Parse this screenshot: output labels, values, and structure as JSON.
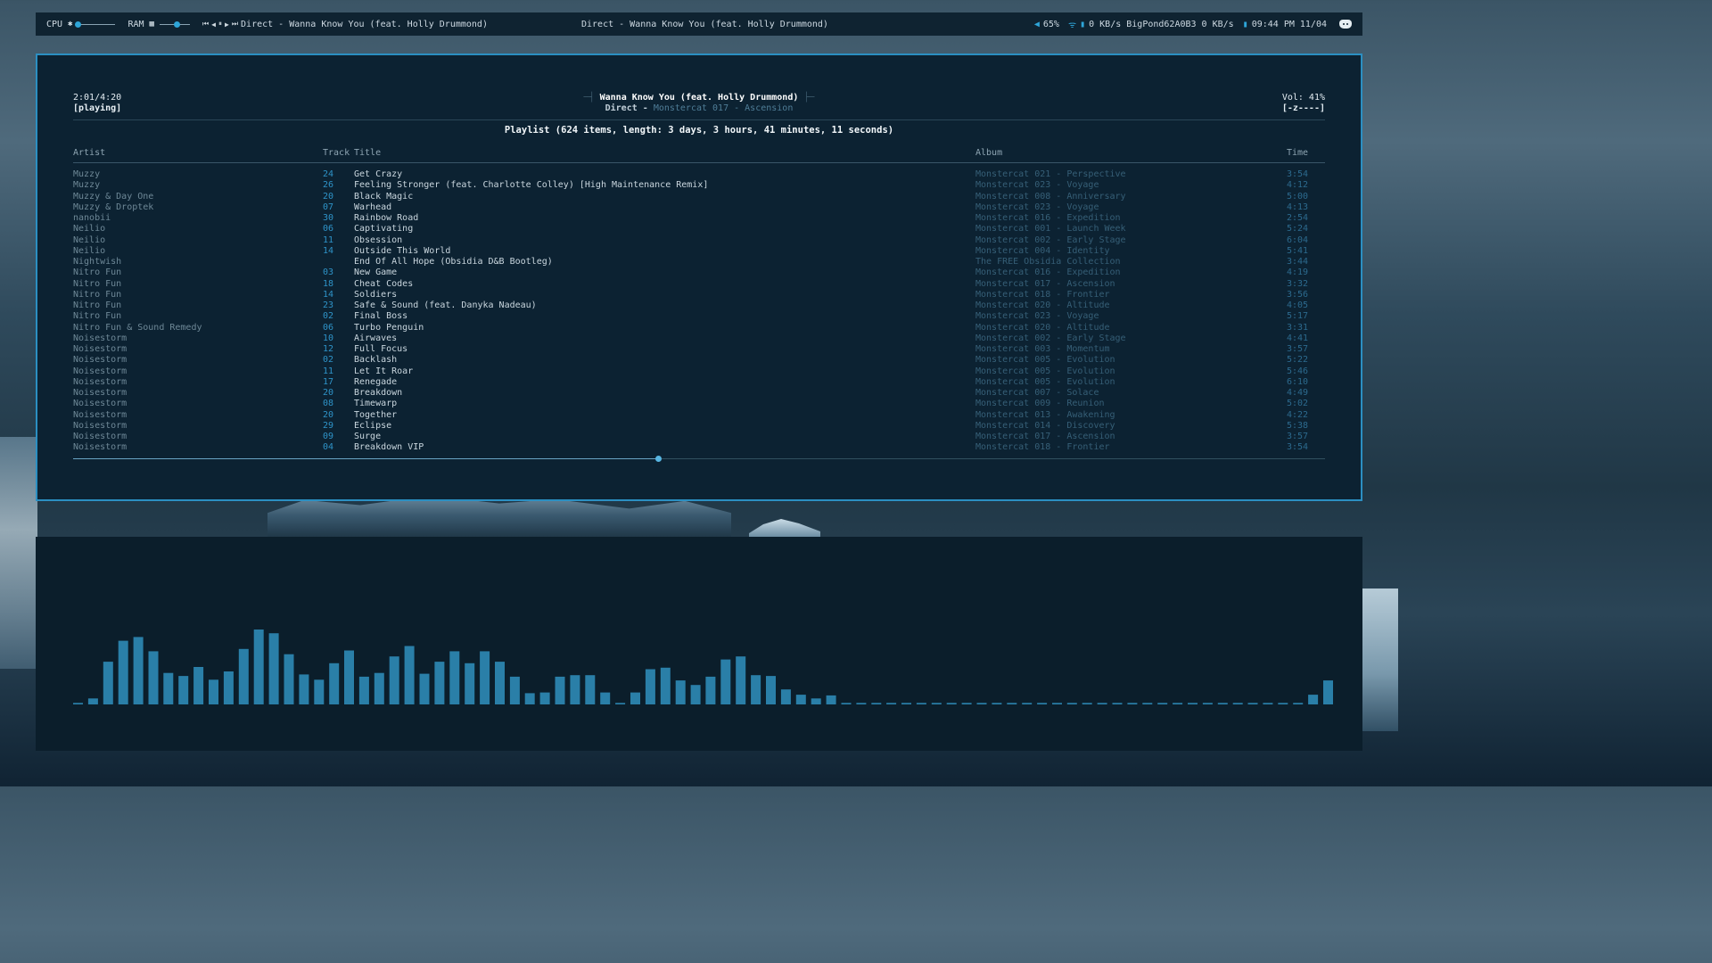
{
  "topbar": {
    "cpu_label": "CPU",
    "ram_label": "RAM",
    "media_controls": [
      "⏮",
      "◀",
      "⏸",
      "▶",
      "⏭"
    ],
    "now_playing": "Direct - Wanna Know You (feat. Holly Drummond)",
    "center_title": "Direct - Wanna Know You (feat. Holly Drummond)",
    "volume": "65%",
    "network": "0 KB/s BigPond62A0B3 0 KB/s",
    "clock": "09:44 PM 11/04",
    "accent": "#2ea5d8"
  },
  "player": {
    "elapsed": "2:01/4:20",
    "state": "[playing]",
    "song_title": "Wanna Know You (feat. Holly Drummond)",
    "artist": "Direct",
    "album": "Monstercat 017 - Ascension",
    "volume": "Vol: 41%",
    "mode_flags": "[-z----]",
    "progress": 0.467
  },
  "playlist": {
    "summary": "Playlist (624 items, length: 3 days, 3 hours, 41 minutes, 11 seconds)",
    "columns": [
      "Artist",
      "Track",
      "Title",
      "Album",
      "Time"
    ],
    "rows": [
      [
        "Muzzy",
        "24",
        "Get Crazy",
        "Monstercat 021 - Perspective",
        "3:54"
      ],
      [
        "Muzzy",
        "26",
        "Feeling Stronger (feat. Charlotte Colley) [High Maintenance Remix]",
        "Monstercat 023 - Voyage",
        "4:12"
      ],
      [
        "Muzzy & Day One",
        "20",
        "Black Magic",
        "Monstercat 008 - Anniversary",
        "5:00"
      ],
      [
        "Muzzy & Droptek",
        "07",
        "Warhead",
        "Monstercat 023 - Voyage",
        "4:13"
      ],
      [
        "nanobii",
        "30",
        "Rainbow Road",
        "Monstercat 016 - Expedition",
        "2:54"
      ],
      [
        "Neilio",
        "06",
        "Captivating",
        "Monstercat 001 - Launch Week",
        "5:24"
      ],
      [
        "Neilio",
        "11",
        "Obsession",
        "Monstercat 002 - Early Stage",
        "6:04"
      ],
      [
        "Neilio",
        "14",
        "Outside This World",
        "Monstercat 004 - Identity",
        "5:41"
      ],
      [
        "Nightwish",
        "",
        "End Of All Hope (Obsidia D&B Bootleg)",
        "The FREE Obsidia Collection",
        "3:44"
      ],
      [
        "Nitro Fun",
        "03",
        "New Game",
        "Monstercat 016 - Expedition",
        "4:19"
      ],
      [
        "Nitro Fun",
        "18",
        "Cheat Codes",
        "Monstercat 017 - Ascension",
        "3:32"
      ],
      [
        "Nitro Fun",
        "14",
        "Soldiers",
        "Monstercat 018 - Frontier",
        "3:56"
      ],
      [
        "Nitro Fun",
        "23",
        "Safe & Sound (feat. Danyka Nadeau)",
        "Monstercat 020 - Altitude",
        "4:05"
      ],
      [
        "Nitro Fun",
        "02",
        "Final Boss",
        "Monstercat 023 - Voyage",
        "5:17"
      ],
      [
        "Nitro Fun & Sound Remedy",
        "06",
        "Turbo Penguin",
        "Monstercat 020 - Altitude",
        "3:31"
      ],
      [
        "Noisestorm",
        "10",
        "Airwaves",
        "Monstercat 002 - Early Stage",
        "4:41"
      ],
      [
        "Noisestorm",
        "12",
        "Full Focus",
        "Monstercat 003 - Momentum",
        "3:57"
      ],
      [
        "Noisestorm",
        "02",
        "Backlash",
        "Monstercat 005 - Evolution",
        "5:22"
      ],
      [
        "Noisestorm",
        "11",
        "Let It Roar",
        "Monstercat 005 - Evolution",
        "5:46"
      ],
      [
        "Noisestorm",
        "17",
        "Renegade",
        "Monstercat 005 - Evolution",
        "6:10"
      ],
      [
        "Noisestorm",
        "20",
        "Breakdown",
        "Monstercat 007 - Solace",
        "4:49"
      ],
      [
        "Noisestorm",
        "08",
        "Timewarp",
        "Monstercat 009 - Reunion",
        "5:02"
      ],
      [
        "Noisestorm",
        "20",
        "Together",
        "Monstercat 013 - Awakening",
        "4:22"
      ],
      [
        "Noisestorm",
        "29",
        "Eclipse",
        "Monstercat 014 - Discovery",
        "5:38"
      ],
      [
        "Noisestorm",
        "09",
        "Surge",
        "Monstercat 017 - Ascension",
        "3:57"
      ],
      [
        "Noisestorm",
        "04",
        "Breakdown VIP",
        "Monstercat 018 - Frontier",
        "3:54"
      ]
    ]
  },
  "visualizer": {
    "color": "#2a7fa8",
    "levels": [
      0.02,
      0.08,
      0.57,
      0.85,
      0.9,
      0.71,
      0.42,
      0.38,
      0.5,
      0.33,
      0.44,
      0.74,
      1.0,
      0.95,
      0.67,
      0.4,
      0.33,
      0.55,
      0.72,
      0.37,
      0.42,
      0.64,
      0.78,
      0.41,
      0.57,
      0.71,
      0.55,
      0.71,
      0.57,
      0.37,
      0.15,
      0.16,
      0.37,
      0.39,
      0.39,
      0.16,
      0.02,
      0.16,
      0.47,
      0.49,
      0.32,
      0.26,
      0.37,
      0.6,
      0.64,
      0.39,
      0.38,
      0.2,
      0.13,
      0.08,
      0.12,
      0.02,
      0.02,
      0.02,
      0.02,
      0.02,
      0.02,
      0.02,
      0.02,
      0.02,
      0.02,
      0.02,
      0.02,
      0.02,
      0.02,
      0.02,
      0.02,
      0.02,
      0.02,
      0.02,
      0.02,
      0.02,
      0.02,
      0.02,
      0.02,
      0.02,
      0.02,
      0.02,
      0.02,
      0.02,
      0.02,
      0.02,
      0.13,
      0.32
    ]
  }
}
